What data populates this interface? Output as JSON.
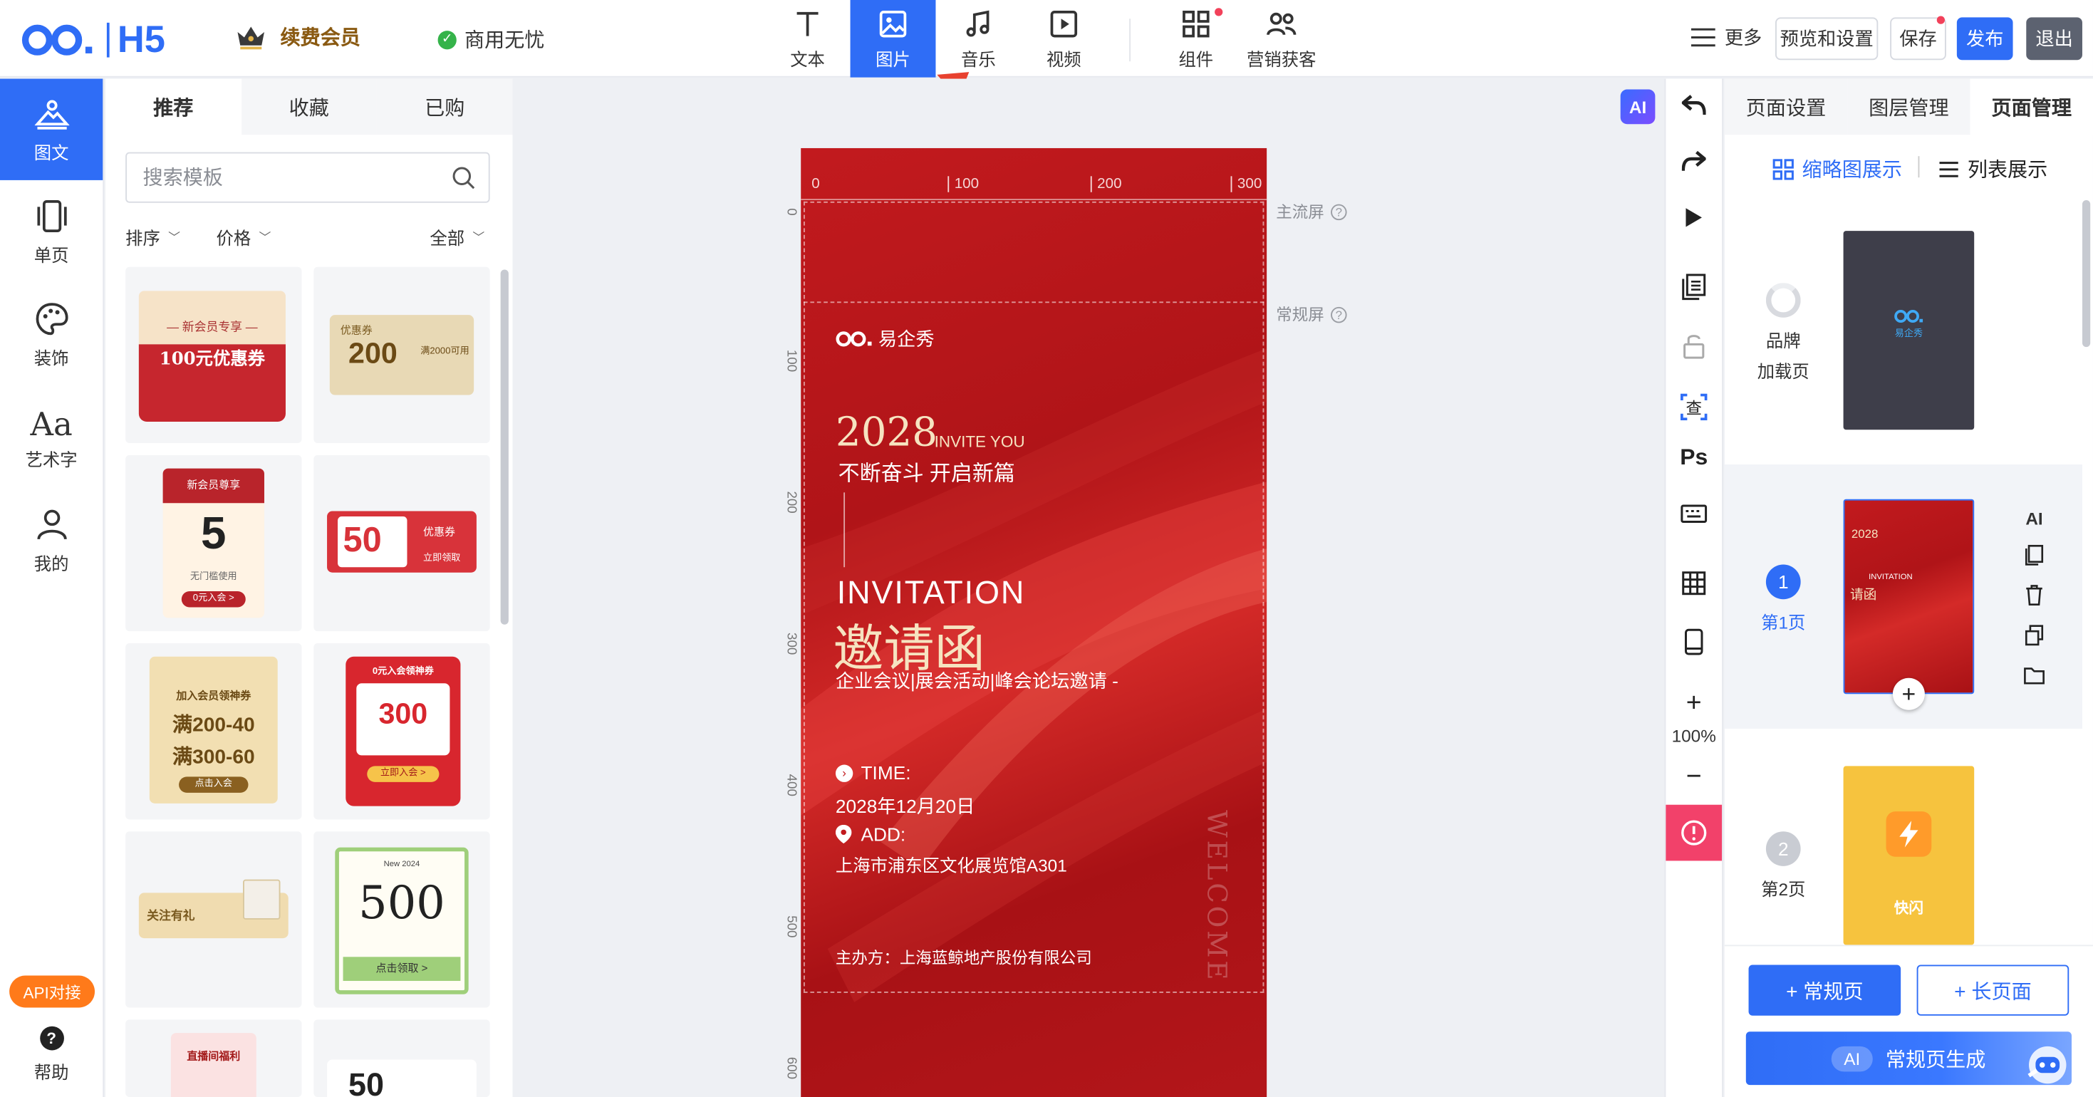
{
  "brand": {
    "logo_text": "C∘O.",
    "product": "H5"
  },
  "header": {
    "vip_label": "续费会员",
    "commercial_label": "商用无忧",
    "tools": [
      {
        "label": "文本",
        "icon": "text-icon"
      },
      {
        "label": "图片",
        "icon": "image-icon",
        "active": true
      },
      {
        "label": "音乐",
        "icon": "music-icon"
      },
      {
        "label": "视频",
        "icon": "video-icon"
      },
      {
        "label": "组件",
        "icon": "component-icon",
        "badge": true
      },
      {
        "label": "营销获客",
        "icon": "users-icon"
      }
    ],
    "more_label": "更多",
    "preview_label": "预览和设置",
    "save_label": "保存",
    "publish_label": "发布",
    "exit_label": "退出"
  },
  "rail": {
    "items": [
      {
        "label": "图文",
        "icon": "mountain-icon",
        "active": true
      },
      {
        "label": "单页",
        "icon": "page-icon"
      },
      {
        "label": "装饰",
        "icon": "palette-icon"
      },
      {
        "label": "艺术字",
        "icon": "art-text-icon"
      },
      {
        "label": "我的",
        "icon": "user-icon"
      }
    ],
    "api_label": "API对接",
    "help_label": "帮助"
  },
  "templates": {
    "tabs": [
      "推荐",
      "收藏",
      "已购"
    ],
    "search_placeholder": "搜索模板",
    "filters": {
      "sort": "排序",
      "price": "价格",
      "all": "全部"
    },
    "cards": [
      {
        "title": "— 新会员专享 —",
        "big": "100元优惠券"
      },
      {
        "title": "优惠券",
        "big": "200",
        "sub": "满2000可用"
      },
      {
        "title": "新会员尊享",
        "big": "5",
        "sub": "无门槛使用",
        "btn": "0元入会 >"
      },
      {
        "title": "优惠券",
        "big": "50",
        "sub": "立即领取"
      },
      {
        "title": "加入会员领神券",
        "big": "满200-40",
        "big2": "满300-60",
        "btn": "点击入会"
      },
      {
        "title": "0元入会领神券",
        "big": "300",
        "btn": "立即入会 >"
      },
      {
        "title": "关注有礼"
      },
      {
        "title": "New 2024",
        "big": "500",
        "btn": "点击领取 >"
      },
      {
        "title": "直播间福利"
      },
      {
        "big": "50"
      }
    ]
  },
  "canvas": {
    "ai_label": "AI",
    "ruler_top": [
      "0",
      "100",
      "200",
      "300"
    ],
    "ruler_left": [
      "0",
      "100",
      "200",
      "300",
      "400",
      "500",
      "600"
    ],
    "main_screen_label": "主流屏",
    "normal_screen_label": "常规屏",
    "invite": {
      "brand": "易企秀",
      "year": "2028",
      "invite_you": "INVITE YOU",
      "slogan": "不断奋斗 开启新篇",
      "invitation_en": "INVITATION",
      "invitation_cn": "邀请函",
      "subtitle": "企业会议|展会活动|峰会论坛邀请 -",
      "time_label": "TIME:",
      "time_value": "2028年12月20日",
      "add_label": "ADD:",
      "add_value": "上海市浦东区文化展览馆A301",
      "host": "主办方：上海蓝鲸地产股份有限公司",
      "welcome": "WELCOME"
    }
  },
  "vtools": {
    "zoom": "100%"
  },
  "right": {
    "tabs": [
      "页面设置",
      "图层管理",
      "页面管理"
    ],
    "view_thumb": "缩略图展示",
    "view_list": "列表展示",
    "pages": [
      {
        "num": "",
        "label": "品牌\n加载页",
        "line1": "品牌",
        "line2": "加载页",
        "thumb_text": "易企秀"
      },
      {
        "num": "1",
        "label": "第1页",
        "thumb_title": "2028",
        "thumb_sub": "INVITATION",
        "thumb_cn": "请函"
      },
      {
        "num": "2",
        "label": "第2页",
        "thumb_text": "快闪"
      }
    ],
    "side_ai": "AI",
    "add_normal": "+ 常规页",
    "add_long": "+ 长页面",
    "ai_gen_badge": "AI",
    "ai_gen_label": "常规页生成"
  }
}
